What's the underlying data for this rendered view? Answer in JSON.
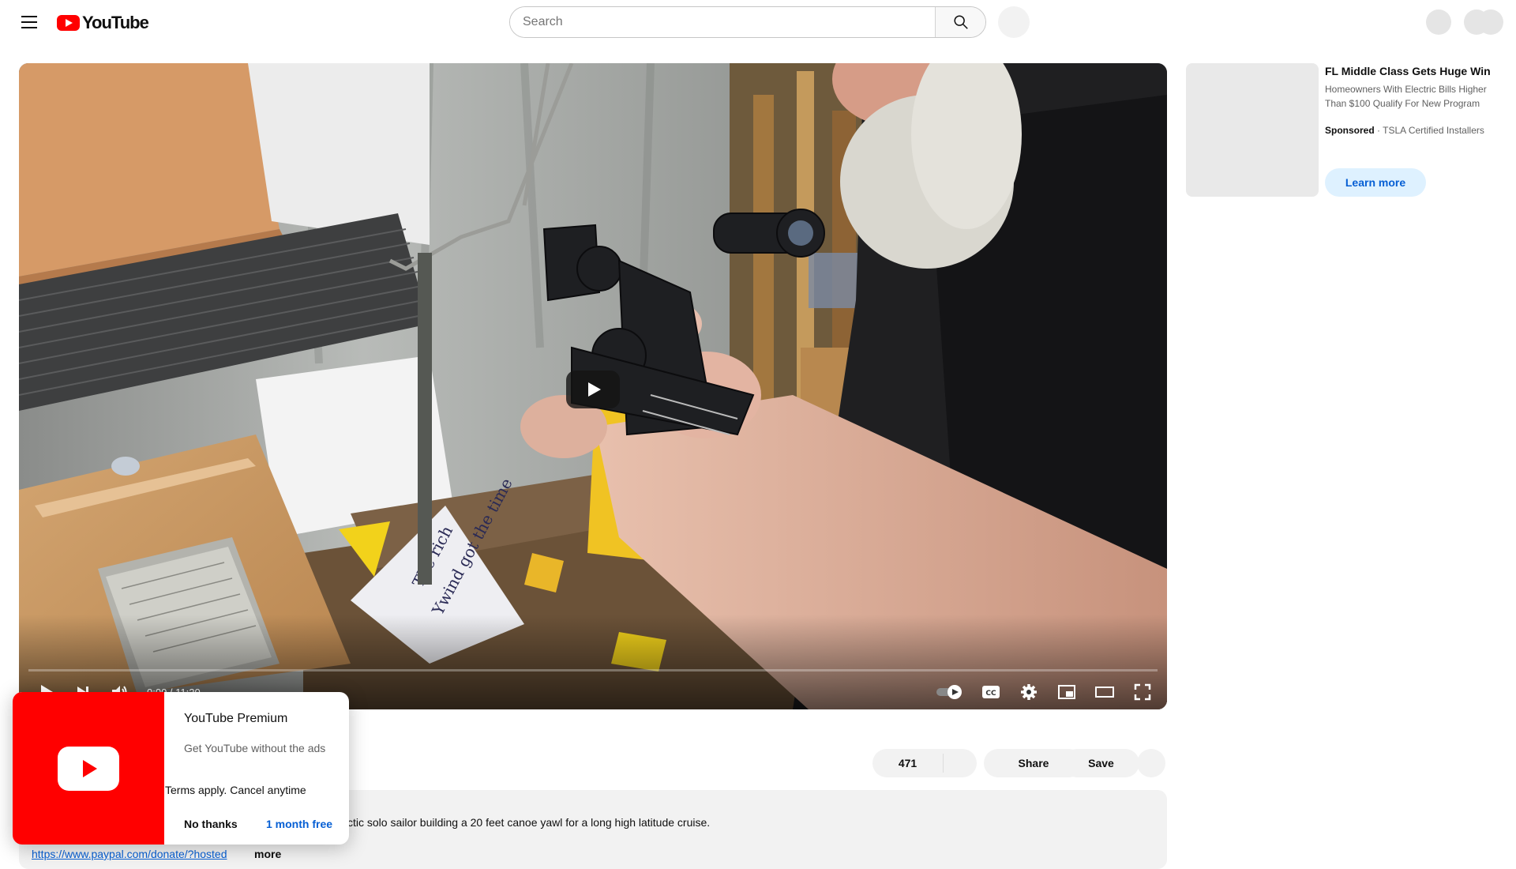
{
  "header": {
    "logo_text": "YouTube",
    "search_placeholder": "Search"
  },
  "player": {
    "time_display": "0:00 / 11:20",
    "progress_fraction": 0,
    "icons": [
      "play-icon",
      "next-icon",
      "volume-icon",
      "autoplay-toggle",
      "captions-icon",
      "settings-icon",
      "miniplayer-icon",
      "theater-icon",
      "fullscreen-icon"
    ],
    "scene_text": {
      "paper_line_1": "The rich",
      "paper_line_2": "Ywind got the time"
    }
  },
  "actions": {
    "like_count": "471",
    "share_label": "Share",
    "save_label": "Save"
  },
  "description": {
    "text": "ctic solo sailor building a 20 feet canoe yawl for a long high latitude cruise.",
    "link": "https://www.paypal.com/donate/?hosted",
    "more_label": "more"
  },
  "ad": {
    "title": "FL Middle Class Gets Huge Win",
    "body": "Homeowners With Electric Bills Higher Than $100 Qualify For New Program",
    "sponsored_label": "Sponsored",
    "advertiser": "TSLA Certified Installers",
    "cta_label": "Learn more"
  },
  "premium_popup": {
    "title": "YouTube Premium",
    "subtitle": "Get YouTube without the ads",
    "terms": "Terms apply. Cancel anytime",
    "dismiss_label": "No thanks",
    "accept_label": "1 month free"
  }
}
